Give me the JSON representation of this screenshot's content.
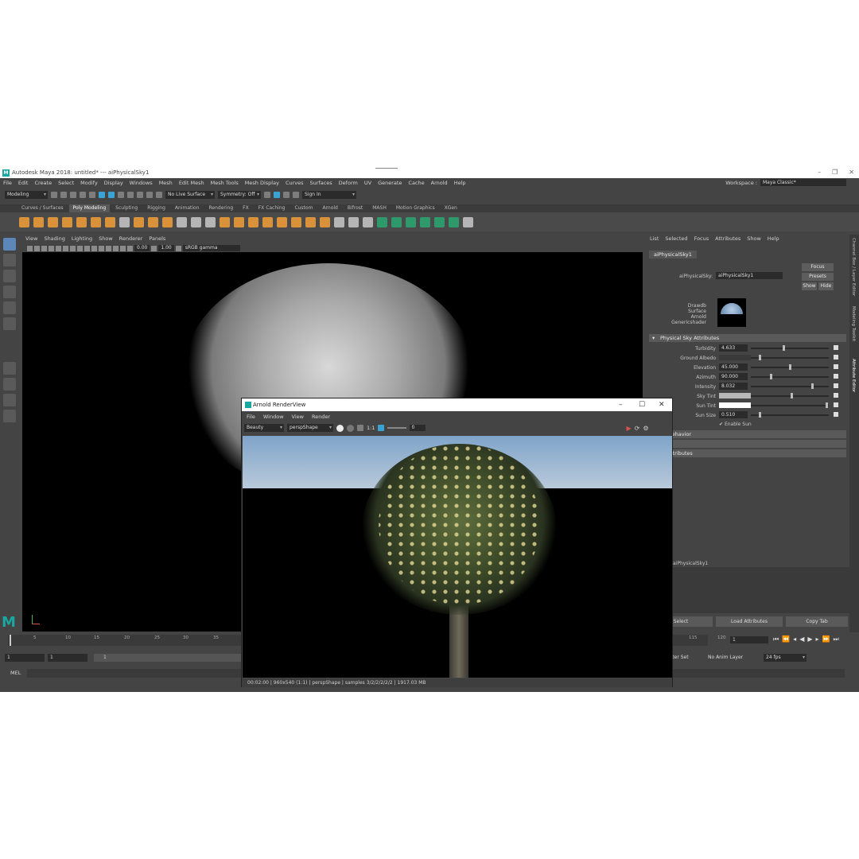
{
  "window": {
    "title": "Autodesk Maya 2018: untitled*   ---   aiPhysicalSky1"
  },
  "menubar": {
    "items": [
      "File",
      "Edit",
      "Create",
      "Select",
      "Modify",
      "Display",
      "Windows",
      "Mesh",
      "Edit Mesh",
      "Mesh Tools",
      "Mesh Display",
      "Curves",
      "Surfaces",
      "Deform",
      "UV",
      "Generate",
      "Cache",
      "Arnold",
      "Help"
    ],
    "workspace_label": "Workspace :",
    "workspace_value": "Maya Classic*"
  },
  "statusline": {
    "mode": "Modeling",
    "live_surface": "No Live Surface",
    "symmetry": "Symmetry: Off",
    "sign_in": "Sign In"
  },
  "shelf_tabs": [
    "Curves / Surfaces",
    "Poly Modeling",
    "Sculpting",
    "Rigging",
    "Animation",
    "Rendering",
    "FX",
    "FX Caching",
    "Custom",
    "Arnold",
    "Bifrost",
    "MASH",
    "Motion Graphics",
    "XGen"
  ],
  "shelf_active": "Poly Modeling",
  "panel": {
    "menu": [
      "View",
      "Shading",
      "Lighting",
      "Show",
      "Renderer",
      "Panels"
    ],
    "val1": "0.00",
    "val2": "1.00",
    "gamma": "sRGB gamma"
  },
  "attribute_editor": {
    "menu": [
      "List",
      "Selected",
      "Focus",
      "Attributes",
      "Show",
      "Help"
    ],
    "node_tab": "aiPhysicalSky1",
    "node_label": "aiPhysicalSky:",
    "node_value": "aiPhysicalSky1",
    "focus": "Focus",
    "presets": "Presets",
    "show": "Show",
    "hide": "Hide",
    "classification": [
      "Drawdb",
      "Surface",
      "Arnold",
      "Genericshader"
    ],
    "section_title": "Physical Sky Attributes",
    "attrs": [
      {
        "label": "Turbidity",
        "value": "4.633"
      },
      {
        "label": "Ground Albedo",
        "value": ""
      },
      {
        "label": "Elevation",
        "value": "45.000"
      },
      {
        "label": "Azimuth",
        "value": "90.000"
      },
      {
        "label": "Intensity",
        "value": "8.032"
      },
      {
        "label": "Sky Tint",
        "value": ""
      },
      {
        "label": "Sun Tint",
        "value": ""
      },
      {
        "label": "Sun Size",
        "value": "0.510"
      }
    ],
    "enable_sun": "Enable Sun",
    "section2": "de Behavior",
    "section3": "p",
    "section4": "ra Attributes",
    "notes_label": "aiPhysicalSky1",
    "btn_select": "Select",
    "btn_load": "Load Attributes",
    "btn_copy": "Copy Tab"
  },
  "side_tabs": [
    "Channel Box / Layer Editor",
    "Modeling Toolkit",
    "Attribute Editor"
  ],
  "timeline": {
    "ticks": [
      "5",
      "10",
      "15",
      "20",
      "25",
      "30",
      "35"
    ],
    "ticks_right": [
      "115",
      "120"
    ],
    "current_frame": "1"
  },
  "range": {
    "start": "1",
    "start2": "1",
    "slider_label": "1",
    "char_set": "cter Set",
    "anim_layer": "No Anim Layer",
    "fps": "24 fps"
  },
  "cmdline": {
    "label": "MEL"
  },
  "arnold_renderview": {
    "title": "Arnold RenderView",
    "menu": [
      "File",
      "Window",
      "View",
      "Render"
    ],
    "aov": "Beauty",
    "camera": "perspShape",
    "ratio": "1:1",
    "exposure": "0",
    "status": "00:02:00 | 960x540 (1:1) | perspShape | samples 3/2/2/2/2/2 | 1917.03 MB"
  }
}
